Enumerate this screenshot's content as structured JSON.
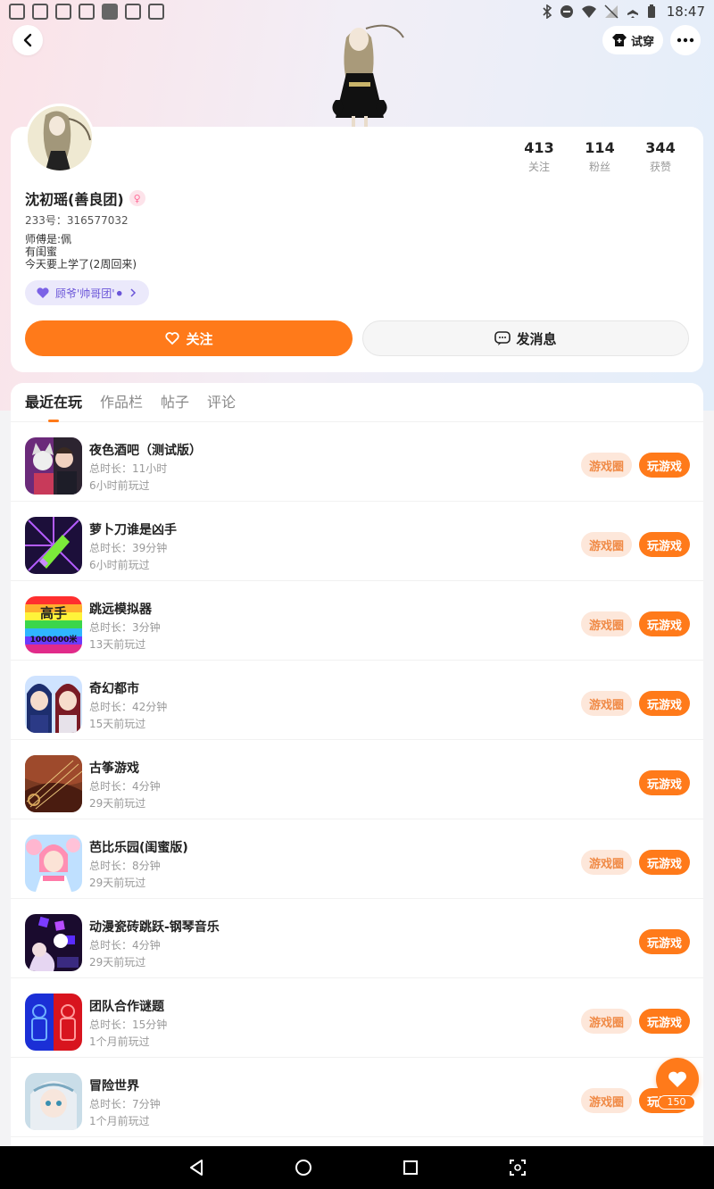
{
  "status_bar": {
    "time": "18:47"
  },
  "header": {
    "try_on_label": "试穿"
  },
  "profile": {
    "name": "沈初瑶(善良团)",
    "id_line": "233号：316577032",
    "bio": [
      "师傅是:佩",
      "有闺蜜",
      "今天要上学了(2周回来)"
    ],
    "team_label": "顾爷'帅哥团'⚫",
    "stats": [
      {
        "value": "413",
        "label": "关注"
      },
      {
        "value": "114",
        "label": "粉丝"
      },
      {
        "value": "344",
        "label": "获赞"
      }
    ],
    "follow_label": "关注",
    "message_label": "发消息"
  },
  "tabs": [
    "最近在玩",
    "作品栏",
    "帖子",
    "评论"
  ],
  "games": [
    {
      "name": "夜色酒吧（测试版）",
      "duration": "总时长：11小时",
      "last": "6小时前玩过",
      "has_circle": true
    },
    {
      "name": "萝卜刀谁是凶手",
      "duration": "总时长：39分钟",
      "last": "6小时前玩过",
      "has_circle": true
    },
    {
      "name": "跳远模拟器",
      "duration": "总时长：3分钟",
      "last": "13天前玩过",
      "has_circle": true
    },
    {
      "name": "奇幻都市",
      "duration": "总时长：42分钟",
      "last": "15天前玩过",
      "has_circle": true
    },
    {
      "name": "古筝游戏",
      "duration": "总时长：4分钟",
      "last": "29天前玩过",
      "has_circle": false
    },
    {
      "name": "芭比乐园(闺蜜版)",
      "duration": "总时长：8分钟",
      "last": "29天前玩过",
      "has_circle": true
    },
    {
      "name": "动漫瓷砖跳跃-钢琴音乐",
      "duration": "总时长：4分钟",
      "last": "29天前玩过",
      "has_circle": false
    },
    {
      "name": "团队合作谜题",
      "duration": "总时长：15分钟",
      "last": "1个月前玩过",
      "has_circle": true
    },
    {
      "name": "冒险世界",
      "duration": "总时长：7分钟",
      "last": "1个月前玩过",
      "has_circle": true
    }
  ],
  "buttons": {
    "circle_label": "游戏圈",
    "play_label": "玩游戏"
  },
  "icon_texts": {
    "jump_game_top": "高手",
    "jump_game_bottom": "1000000米"
  },
  "like": {
    "count": "150"
  },
  "colors": {
    "accent": "#ff7a1a",
    "circle_bg": "#fde7da",
    "team_purple": "#6a55d8"
  },
  "icons": [
    "back-icon",
    "tshirt-icon",
    "more-icon",
    "gender-icon",
    "heart-icon",
    "chat-icon",
    "like-icon",
    "nav-back-icon",
    "nav-home-icon",
    "nav-recents-icon",
    "nav-screenshot-icon"
  ]
}
